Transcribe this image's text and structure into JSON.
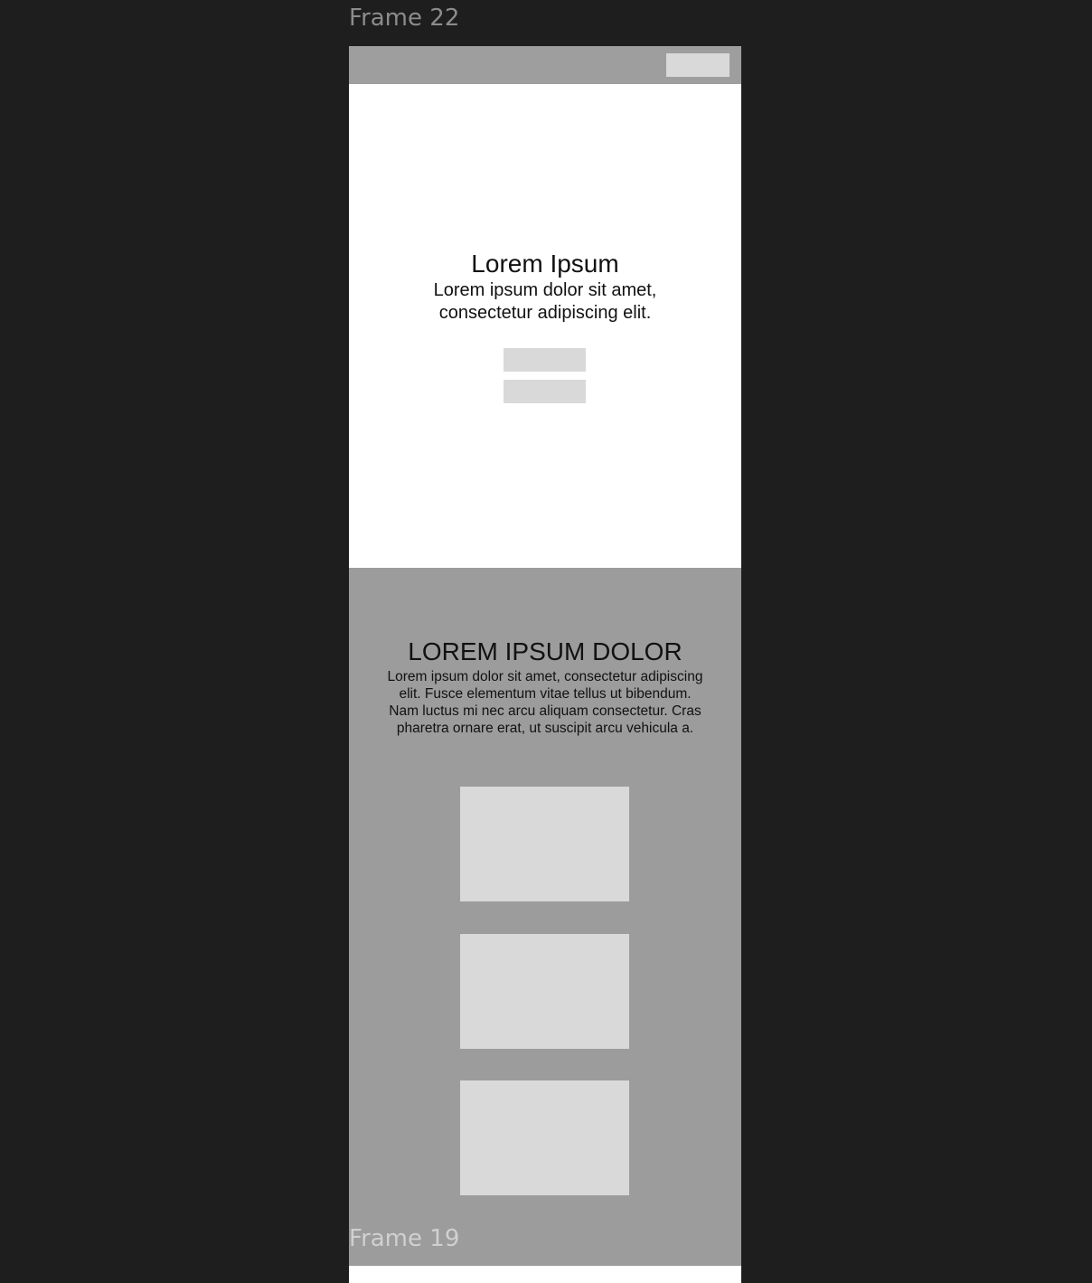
{
  "canvas": {
    "background": "#1e1e1e"
  },
  "frame22": {
    "label": "Frame 22",
    "topbar": {
      "color": "#9e9e9e"
    },
    "hero": {
      "title": "Lorem Ipsum",
      "text": "Lorem ipsum dolor sit amet, consectetur adipiscing elit."
    },
    "placeholder_color": "#d9d9d9"
  },
  "frame19": {
    "label": "Frame 19",
    "background": "#9c9c9c",
    "title": "LOREM IPSUM DOLOR",
    "text": "Lorem ipsum dolor sit amet, consectetur adipiscing elit. Fusce elementum vitae tellus ut bibendum. Nam luctus mi nec arcu aliquam consectetur. Cras pharetra ornare erat, ut suscipit arcu vehicula a."
  }
}
